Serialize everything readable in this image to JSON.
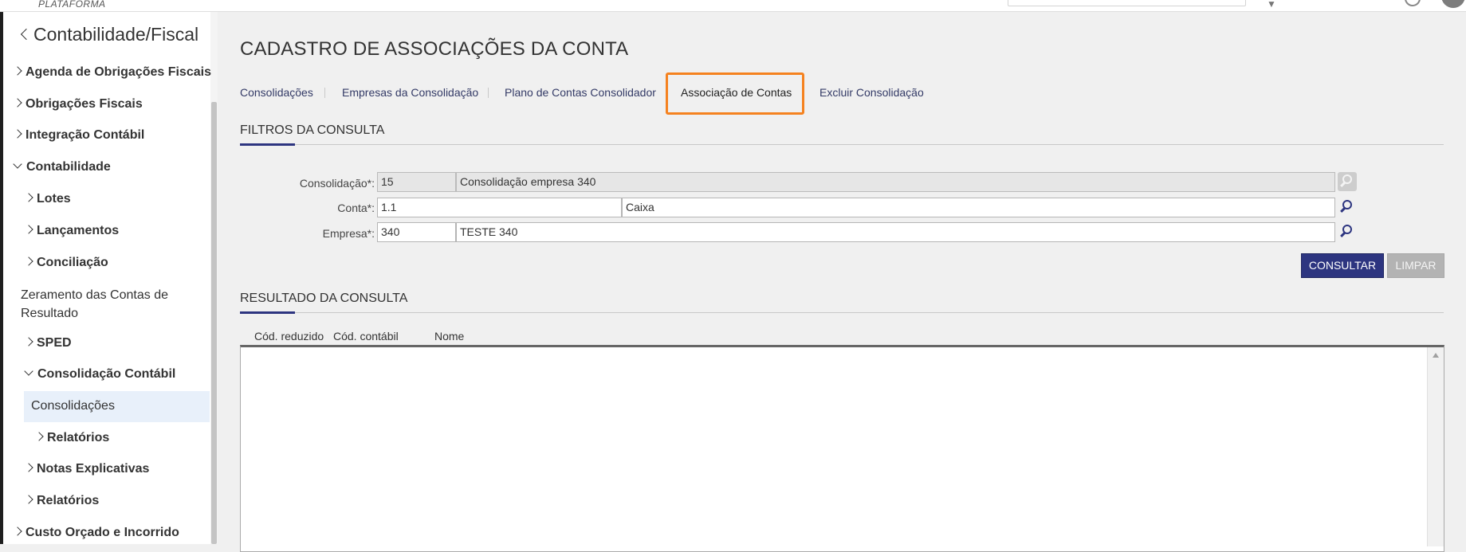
{
  "header": {
    "brand": "PLATAFORMA"
  },
  "sidebar": {
    "title": "Contabilidade/Fiscal",
    "items": [
      {
        "label": "Agenda de Obrigações Fiscais",
        "state": "collapsed"
      },
      {
        "label": "Obrigações Fiscais",
        "state": "collapsed"
      },
      {
        "label": "Integração Contábil",
        "state": "collapsed"
      },
      {
        "label": "Contabilidade",
        "state": "expanded"
      },
      {
        "label": "Lotes",
        "state": "collapsed"
      },
      {
        "label": "Lançamentos",
        "state": "collapsed"
      },
      {
        "label": "Conciliação",
        "state": "collapsed"
      },
      {
        "label": "Zeramento das Contas de",
        "label2": "Resultado"
      },
      {
        "label": "SPED",
        "state": "collapsed"
      },
      {
        "label": "Consolidação Contábil",
        "state": "expanded"
      },
      {
        "label": "Consolidações",
        "state": "selected"
      },
      {
        "label": "Relatórios",
        "state": "collapsed"
      },
      {
        "label": "Notas Explicativas",
        "state": "collapsed"
      },
      {
        "label": "Relatórios",
        "state": "collapsed"
      },
      {
        "label": "Custo Orçado e Incorrido",
        "state": "collapsed"
      }
    ]
  },
  "page": {
    "title": "CADASTRO DE ASSOCIAÇÕES DA CONTA"
  },
  "tabs": [
    {
      "label": "Consolidações"
    },
    {
      "label": "Empresas da Consolidação"
    },
    {
      "label": "Plano de Contas Consolidador"
    },
    {
      "label": "Associação de Contas",
      "active": true
    },
    {
      "label": "Excluir Consolidação"
    }
  ],
  "filters": {
    "section_title": "FILTROS DA CONSULTA",
    "consolidacao": {
      "label": "Consolidação*:",
      "code": "15",
      "description": "Consolidação empresa 340"
    },
    "conta": {
      "label": "Conta*:",
      "code": "1.1",
      "description": "Caixa"
    },
    "empresa": {
      "label": "Empresa*:",
      "code": "340",
      "description": "TESTE 340"
    },
    "consultar_label": "CONSULTAR",
    "limpar_label": "LIMPAR"
  },
  "results": {
    "section_title": "RESULTADO DA CONSULTA",
    "columns": [
      "Cód. reduzido",
      "Cód. contábil",
      "Nome"
    ],
    "rows": []
  },
  "colors": {
    "primary": "#2d3580",
    "active_tab_highlight": "#f5821f",
    "selected_menu_bg": "#e8f0fa"
  }
}
